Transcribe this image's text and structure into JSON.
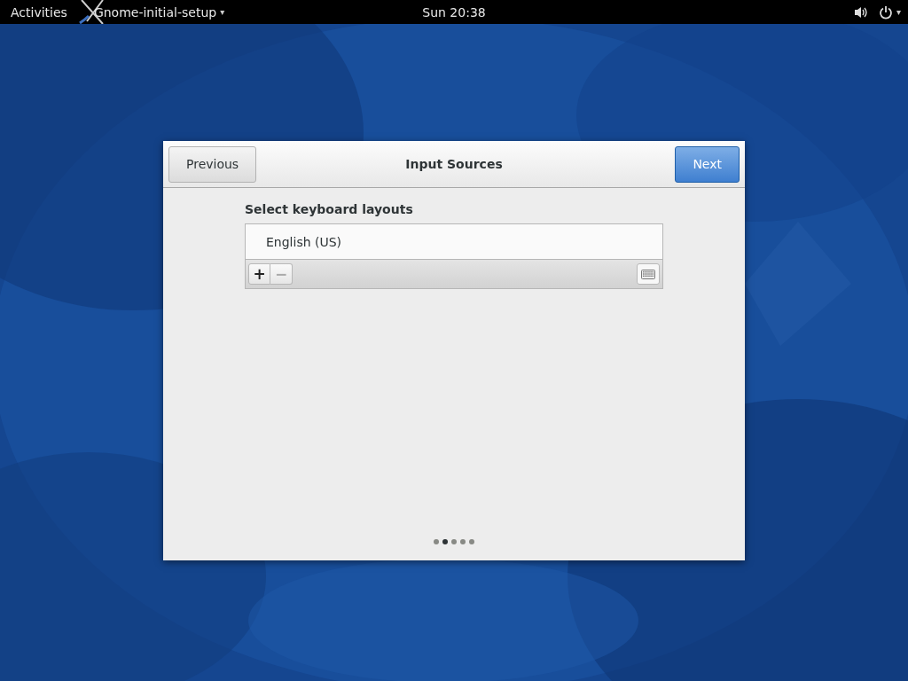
{
  "top_bar": {
    "activities": "Activities",
    "app_menu": "Gnome-initial-setup",
    "app_menu_arrow": "▾",
    "clock": "Sun 20:38",
    "system_arrow": "▾"
  },
  "dialog": {
    "title": "Input Sources",
    "buttons": [
      {
        "label": "Previous",
        "kind": "normal"
      },
      {
        "label": "Next",
        "kind": "suggested"
      }
    ],
    "section_label": "Select keyboard layouts",
    "layouts": [
      {
        "label": "English (US)",
        "selected": false
      }
    ],
    "toolbar": {
      "add": "+",
      "remove": "−",
      "remove_disabled": true
    },
    "pages": [
      {
        "selected": false
      },
      {
        "selected": true
      },
      {
        "selected": false
      },
      {
        "selected": false
      },
      {
        "selected": false
      }
    ]
  }
}
